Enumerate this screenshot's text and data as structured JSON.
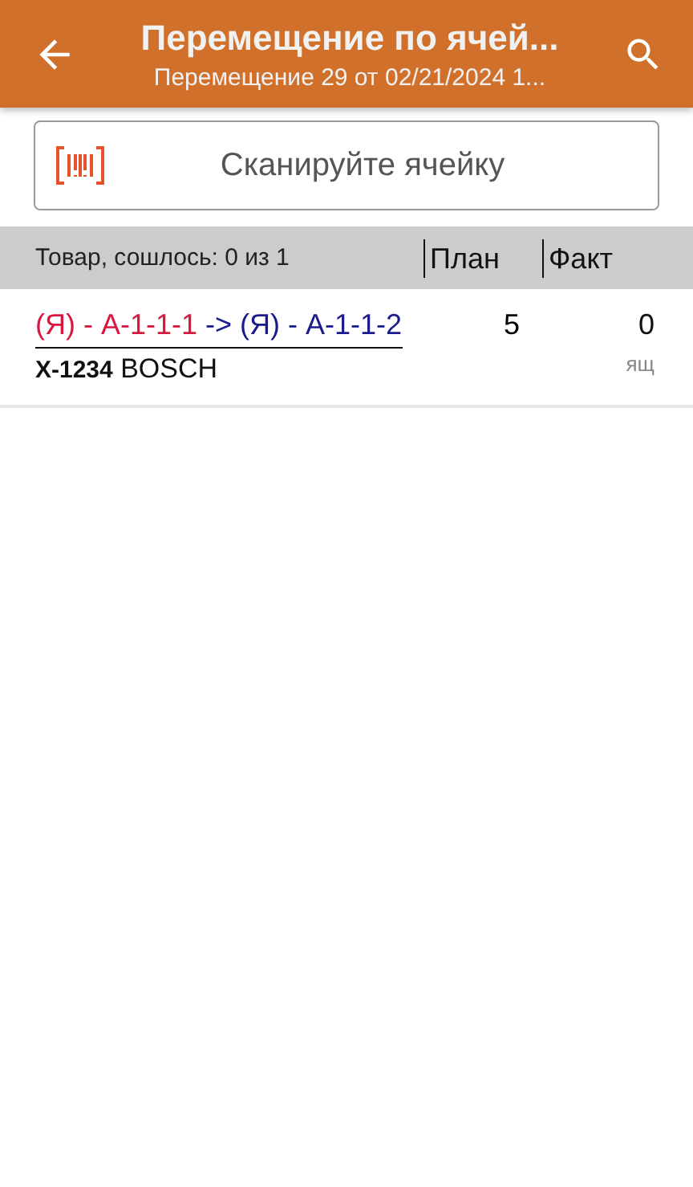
{
  "app_bar": {
    "title": "Перемещение по ячей...",
    "subtitle": "Перемещение 29 от 02/21/2024 1..."
  },
  "scan_field": {
    "placeholder": "Сканируйте ячейку"
  },
  "table": {
    "columns": [
      "Товар, сошлось: 0 из 1",
      "План",
      "Факт"
    ],
    "rows": [
      {
        "source_cell": "(Я) - А-1-1-1",
        "target_cell": "-> (Я) - А-1-1-2",
        "product": "**X-1234** BOSCH",
        "plan": "5",
        "fact": "0",
        "unit": "ящ"
      }
    ]
  }
}
